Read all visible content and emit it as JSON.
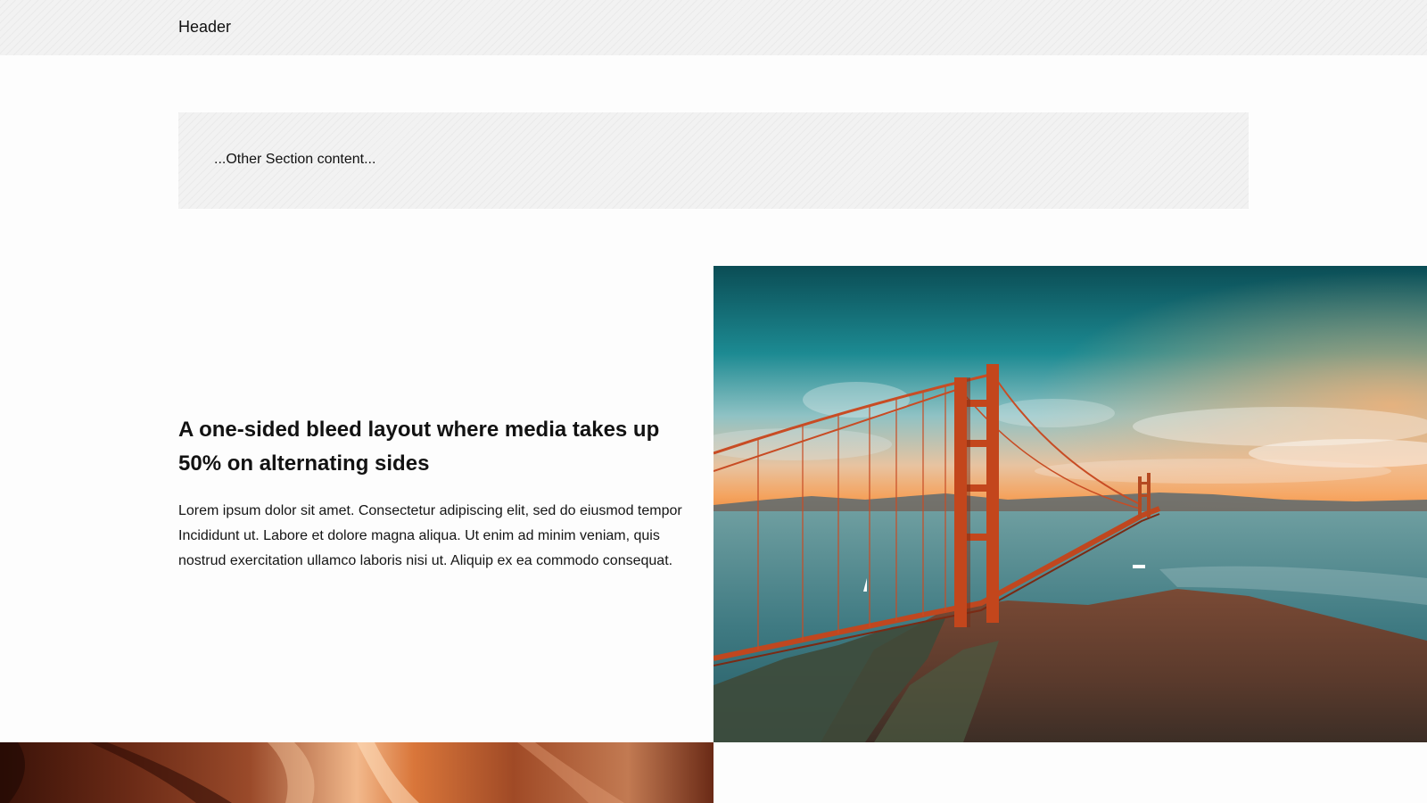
{
  "header": {
    "title": "Header"
  },
  "other_section": {
    "text": "...Other Section content..."
  },
  "feature": {
    "title": "A one-sided bleed layout where media takes up 50% on alternating sides",
    "body": "Lorem ipsum dolor sit amet. Consectetur adipiscing elit, sed do eiusmod tempor Incididunt ut. Labore et dolore magna aliqua. Ut enim ad minim veniam, quis nostrud exercitation ullamco laboris nisi ut. Aliquip ex ea commodo consequat."
  },
  "colors": {
    "background": "#fdfdfd",
    "hatch_panel": "#f2f2f2",
    "text": "#1a1a1a"
  }
}
